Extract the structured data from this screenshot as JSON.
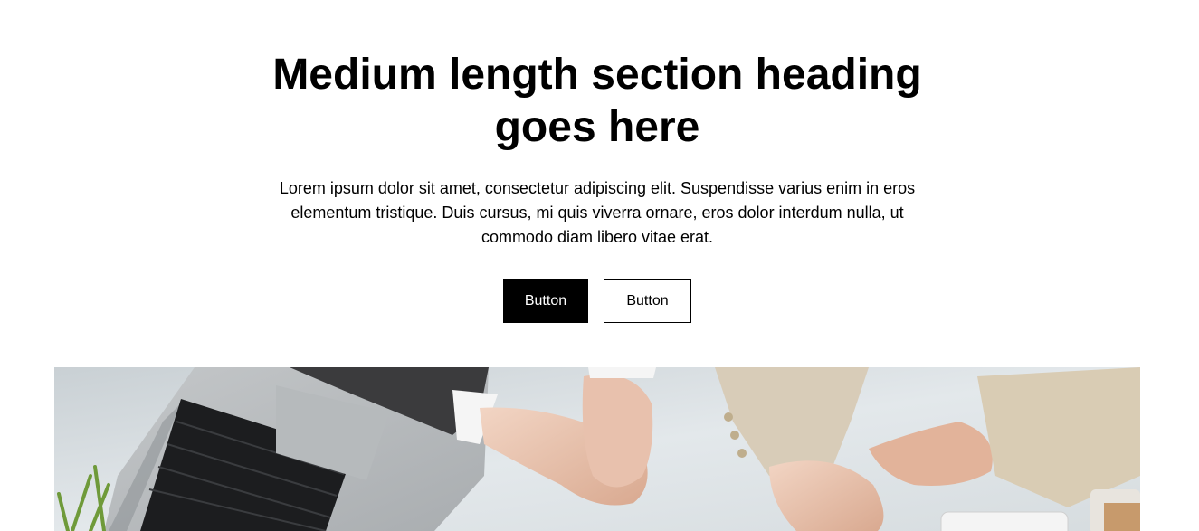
{
  "section": {
    "heading": "Medium length section heading goes here",
    "description": "Lorem ipsum dolor sit amet, consectetur adipiscing elit. Suspendisse varius enim in eros elementum tristique. Duis cursus, mi quis viverra ornare, eros dolor interdum nulla, ut commodo diam libero vitae erat.",
    "primary_button_label": "Button",
    "secondary_button_label": "Button"
  },
  "colors": {
    "primary_button_bg": "#000000",
    "secondary_button_bg": "#ffffff",
    "text": "#000000"
  }
}
